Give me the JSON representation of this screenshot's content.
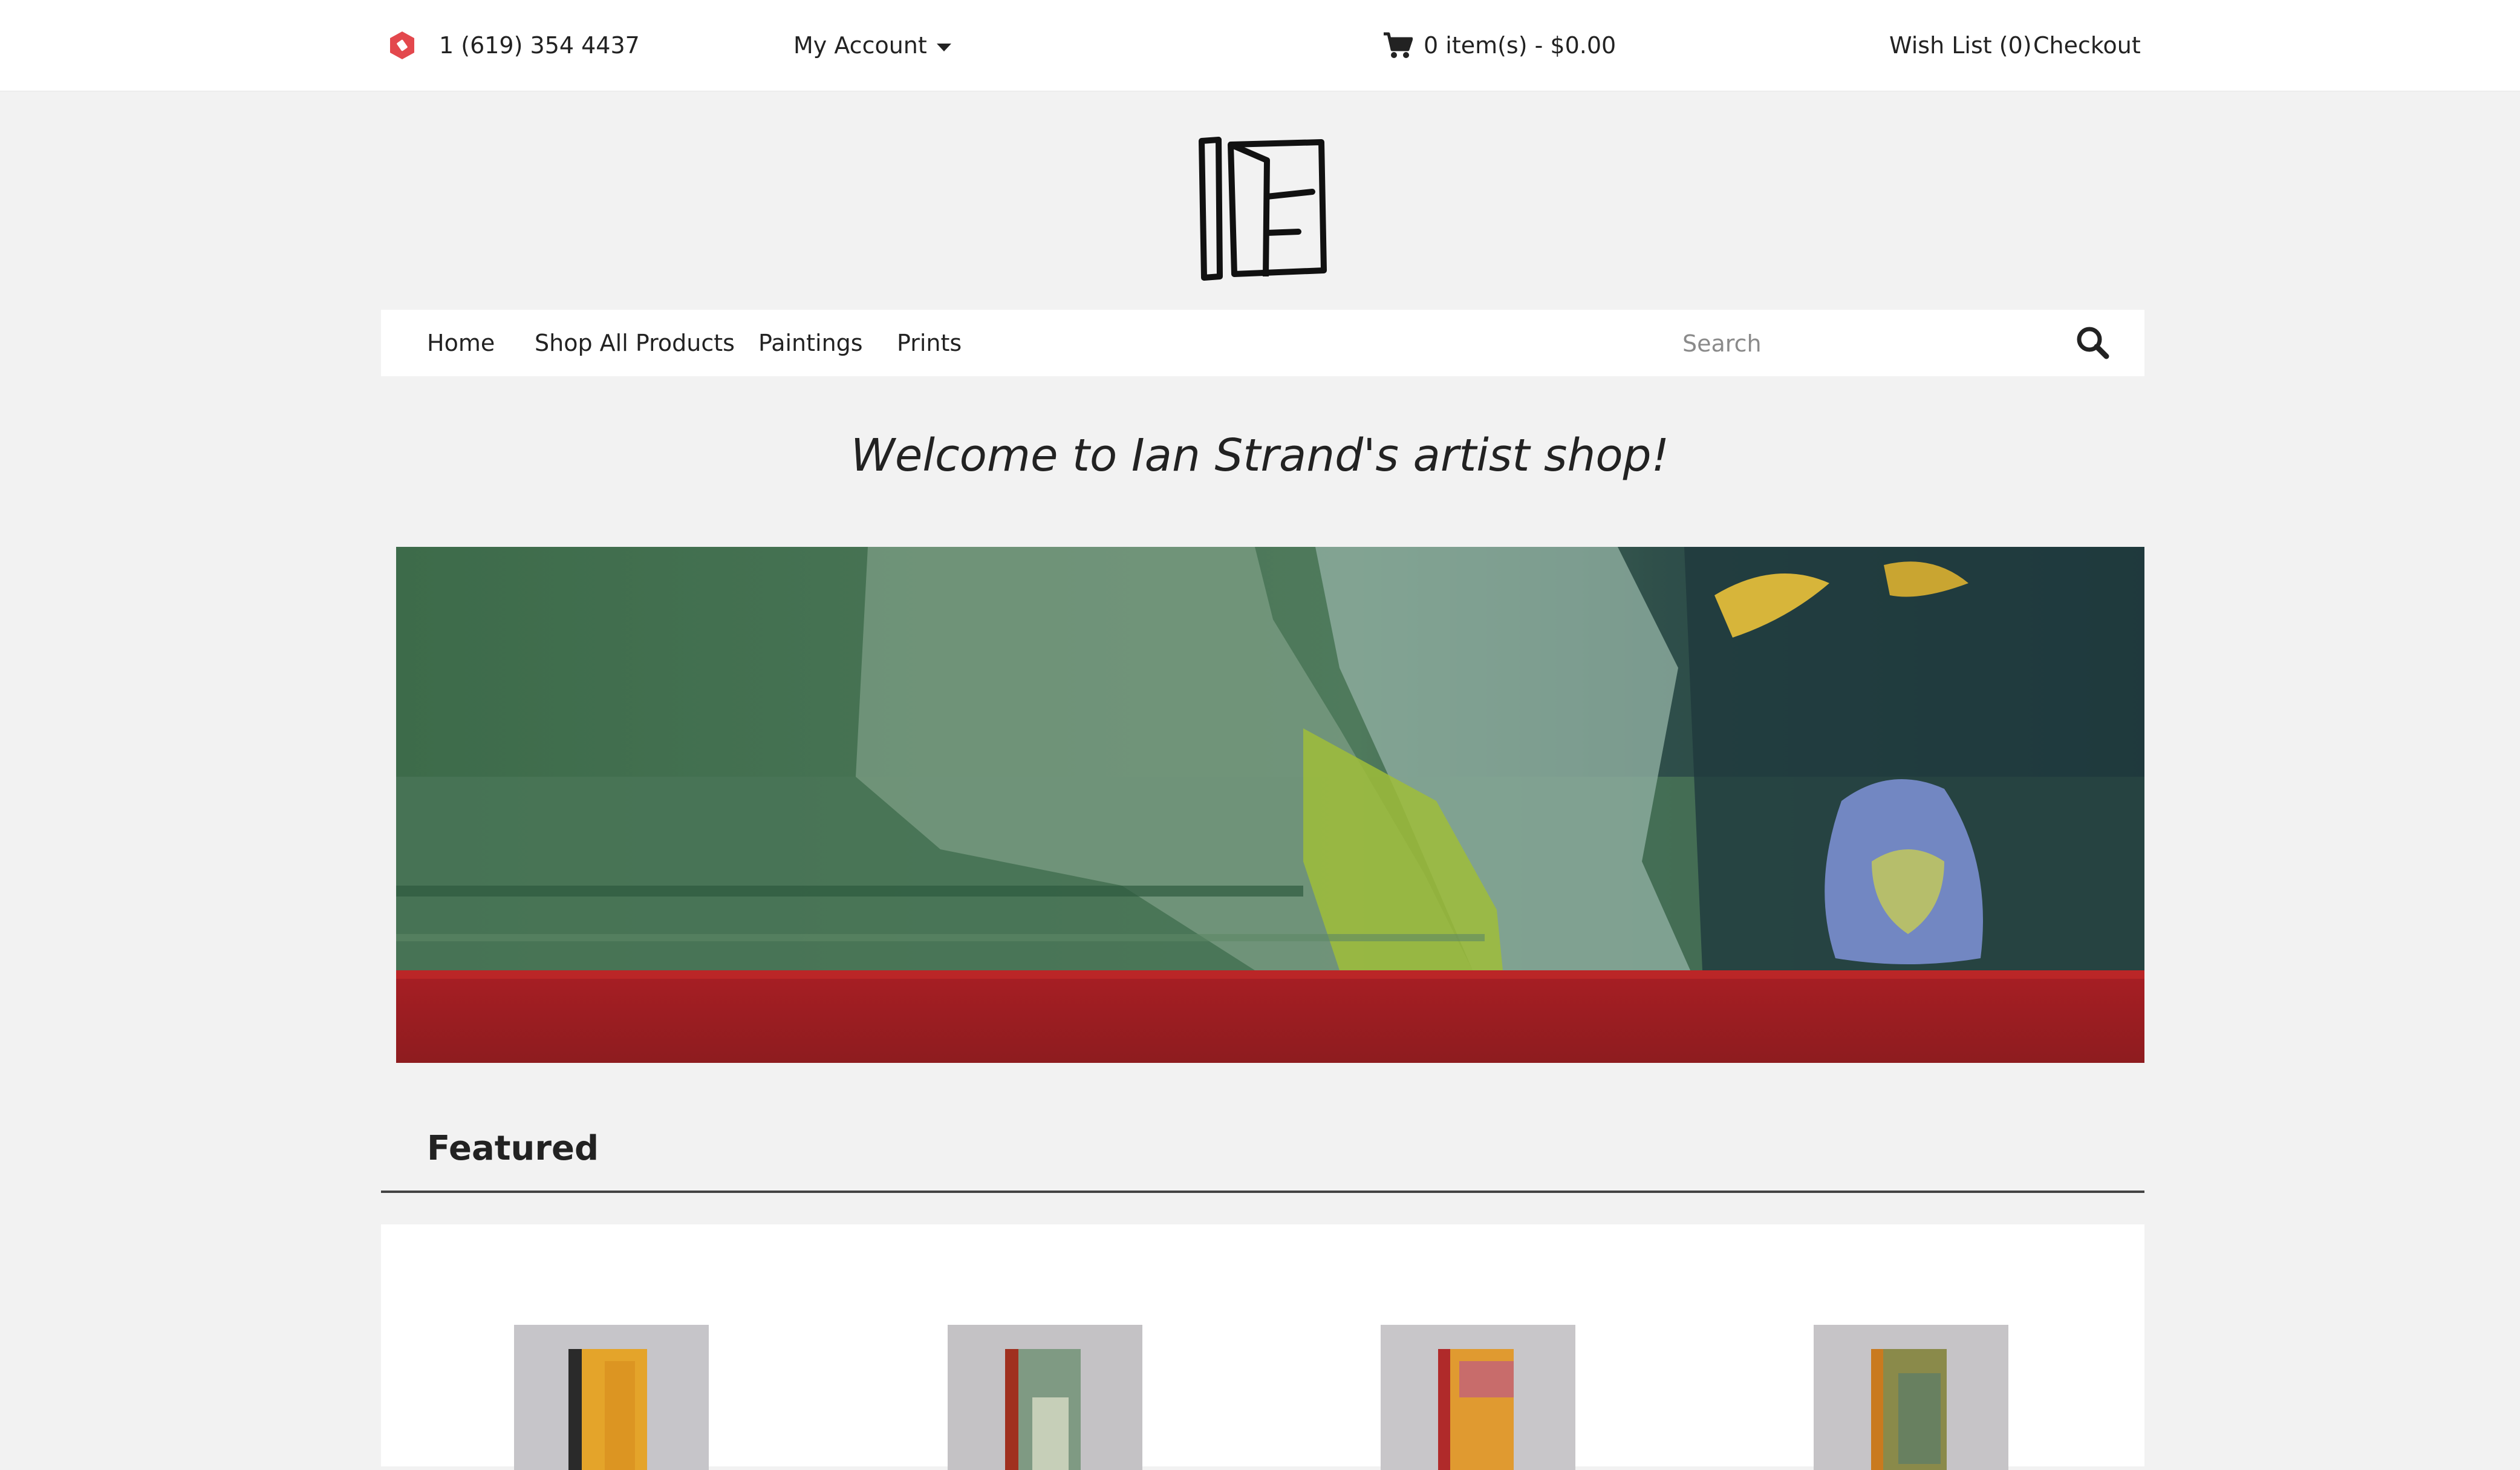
{
  "topbar": {
    "phone": "1 (619) 354 4437",
    "my_account": "My Account",
    "cart": "0 item(s) - $0.00",
    "wishlist": "Wish List (0)",
    "checkout": "Checkout"
  },
  "nav": {
    "items": [
      {
        "label": "Home"
      },
      {
        "label": "Shop All Products"
      },
      {
        "label": "Paintings"
      },
      {
        "label": "Prints"
      }
    ],
    "search_placeholder": "Search"
  },
  "welcome": "Welcome to Ian Strand's artist shop!",
  "featured": {
    "title": "Featured"
  },
  "icons": {
    "phone_badge": "phone-badge-icon",
    "caret": "caret-down-icon",
    "cart": "cart-icon",
    "search": "search-icon"
  },
  "colors": {
    "badge": "#e3484d",
    "background": "#f2f2f2",
    "banner_green": "#3f6b4c",
    "banner_red": "#b52a2a"
  }
}
